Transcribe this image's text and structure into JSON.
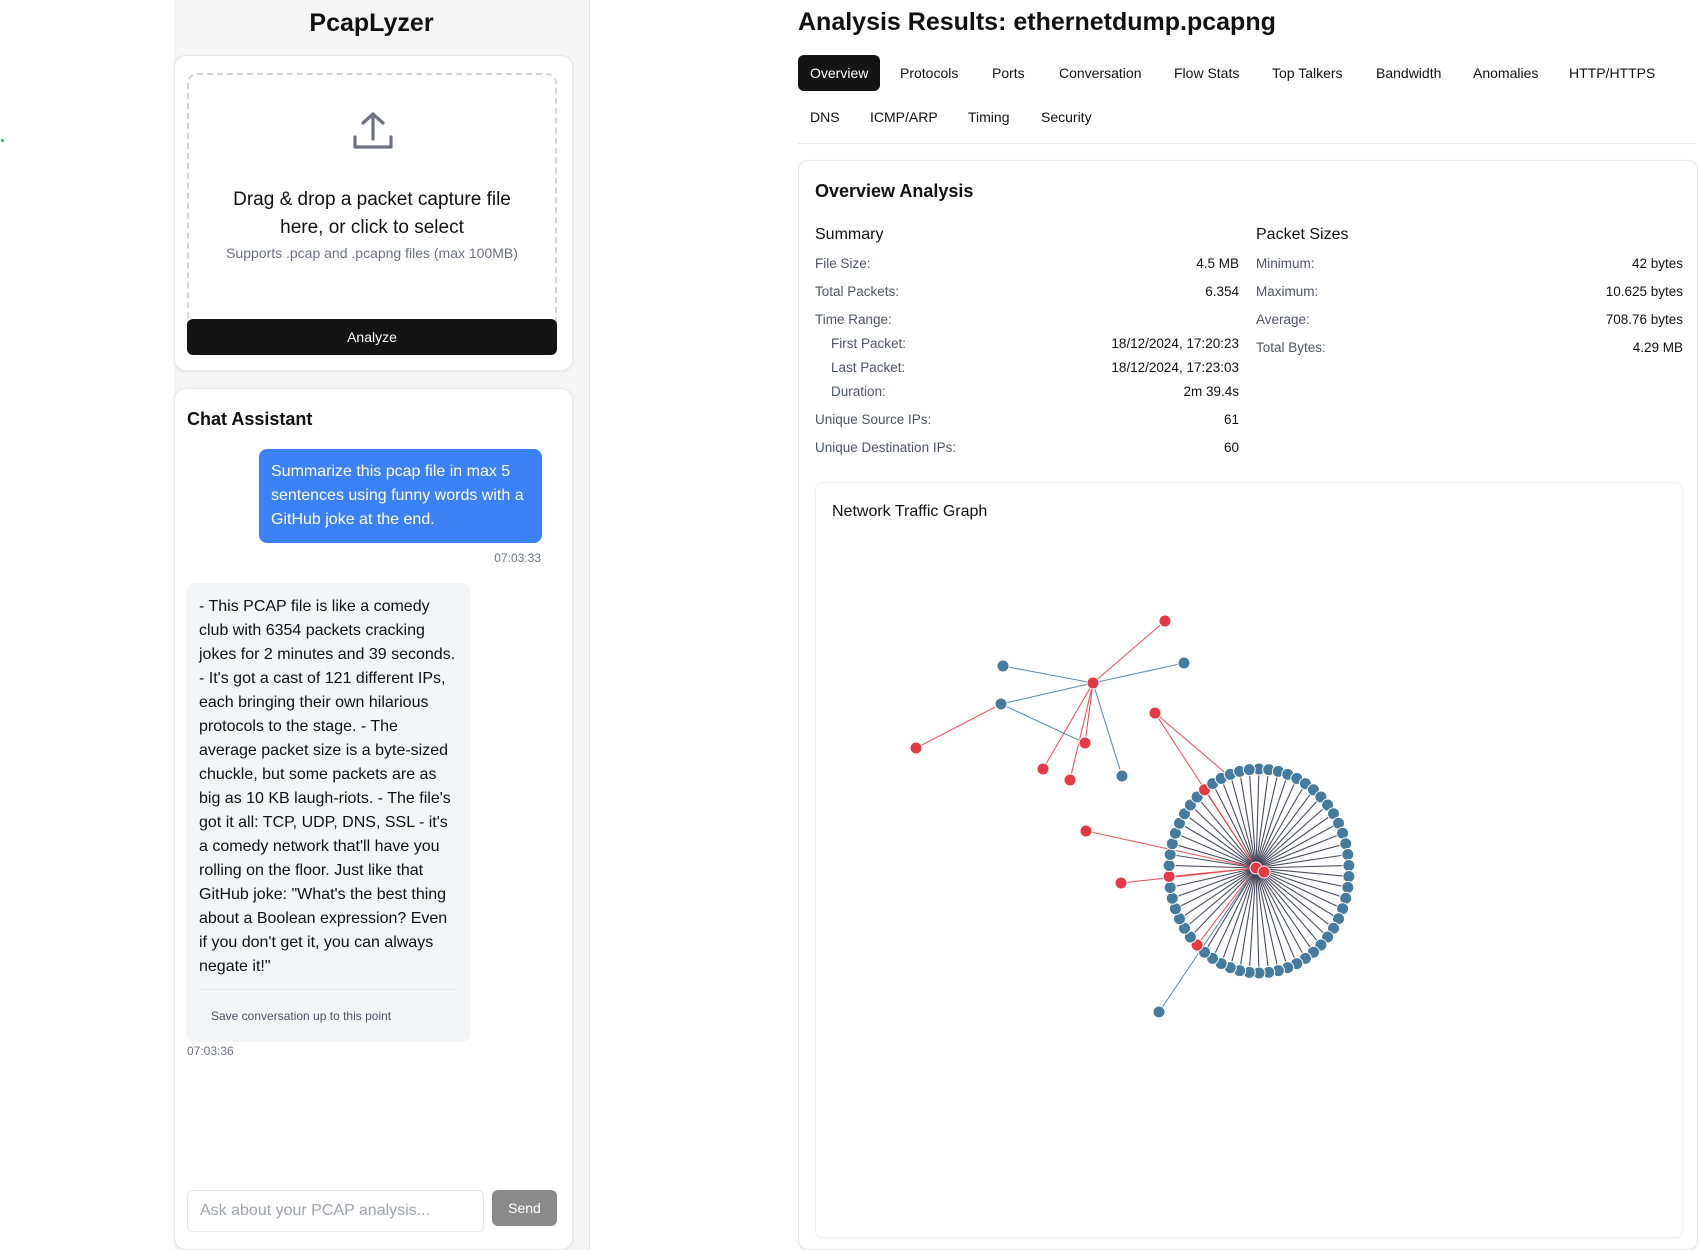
{
  "app": {
    "title": "PcapLyzer"
  },
  "upload": {
    "drop_text": "Drag & drop a packet capture file here, or click to select",
    "hint": "Supports .pcap and .pcapng files (max 100MB)",
    "analyze_label": "Analyze"
  },
  "chat": {
    "title": "Chat Assistant",
    "user_message": "Summarize this pcap file in max 5 sentences using funny words with a GitHub joke at the end.",
    "user_time": "07:03:33",
    "assistant_message": "- This PCAP file is like a comedy club with 6354 packets cracking jokes for 2 minutes and 39 seconds. - It's got a cast of 121 different IPs, each bringing their own hilarious protocols to the stage. - The average packet size is a byte-sized chuckle, but some packets are as big as 10 KB laugh-riots. - The file's got it all: TCP, UDP, DNS, SSL - it's a comedy network that'll have you rolling on the floor. Just like that GitHub joke: \"What's the best thing about a Boolean expression? Even if you don't get it, you can always negate it!\"",
    "save_label": "Save conversation up to this point",
    "assistant_time": "07:03:36",
    "input_placeholder": "Ask about your PCAP analysis...",
    "send_label": "Send"
  },
  "results": {
    "title": "Analysis Results: ethernetdump.pcapng",
    "tabs": [
      "Overview",
      "Protocols",
      "Ports",
      "Conversation",
      "Flow Stats",
      "Top Talkers",
      "Bandwidth",
      "Anomalies",
      "HTTP/HTTPS",
      "DNS",
      "ICMP/ARP",
      "Timing",
      "Security"
    ],
    "active_tab": "Overview"
  },
  "overview": {
    "title": "Overview Analysis",
    "summary": {
      "heading": "Summary",
      "file_size_label": "File Size:",
      "file_size": "4.5 MB",
      "total_packets_label": "Total Packets:",
      "total_packets": "6.354",
      "time_range_label": "Time Range:",
      "first_packet_label": "First Packet:",
      "first_packet": "18/12/2024, 17:20:23",
      "last_packet_label": "Last Packet:",
      "last_packet": "18/12/2024, 17:23:03",
      "duration_label": "Duration:",
      "duration": "2m 39.4s",
      "unique_src_label": "Unique Source IPs:",
      "unique_src": "61",
      "unique_dst_label": "Unique Destination IPs:",
      "unique_dst": "60"
    },
    "packet_sizes": {
      "heading": "Packet Sizes",
      "min_label": "Minimum:",
      "min": "42 bytes",
      "max_label": "Maximum:",
      "max": "10.625 bytes",
      "avg_label": "Average:",
      "avg": "708.76 bytes",
      "total_label": "Total Bytes:",
      "total": "4.29 MB"
    },
    "graph": {
      "title": "Network Traffic Graph",
      "node_colors": {
        "destination": "#457b9d",
        "source": "#e63946"
      },
      "edge_colors": {
        "outgoing": "#e63946",
        "incoming": "#457b9d",
        "hub": "#2b2d42"
      }
    }
  }
}
